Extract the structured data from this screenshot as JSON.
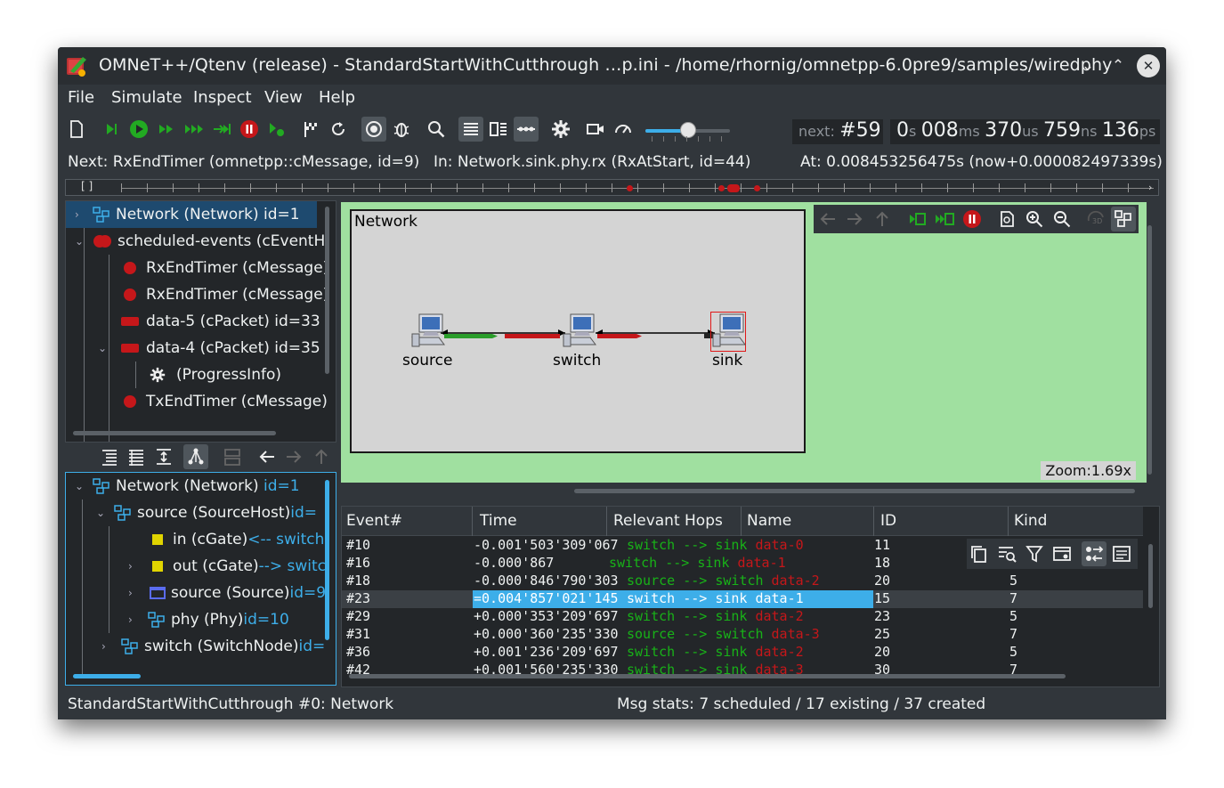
{
  "window": {
    "title": "OMNeT++/Qtenv (release) - StandardStartWithCutthrough …p.ini - /home/rhornig/omnetpp-6.0pre9/samples/wiredphy",
    "btn_minimize": "⌄",
    "btn_maximize": "⌃",
    "btn_close": "✕"
  },
  "menu": [
    "File",
    "Simulate",
    "Inspect",
    "View",
    "Help"
  ],
  "toolbar": {
    "next_label": "next:",
    "next_event": "#59",
    "time": {
      "s": "0",
      "s_unit": "s",
      "ms": "008",
      "ms_unit": "ms",
      "us": "370",
      "us_unit": "us",
      "ns": "759",
      "ns_unit": "ns",
      "ps": "136",
      "ps_unit": "ps"
    },
    "speed_slider_value": 0.5
  },
  "infobar": {
    "next": "Next: RxEndTimer (omnetpp::cMessage, id=9)",
    "in": "In: Network.sink.phy.rx (RxAtStart, id=44)",
    "at": "At: 0.008453256475s (now+0.000082497339s)"
  },
  "timeline": {
    "brackets": "[  ]"
  },
  "object_tree": [
    {
      "label": "Network (Network) id=1",
      "icon": "network-icon"
    },
    {
      "label": "scheduled-events (cEventH",
      "icon": "event-queue-icon"
    },
    {
      "label": "RxEndTimer (cMessage)",
      "icon": "message-icon"
    },
    {
      "label": "RxEndTimer (cMessage)",
      "icon": "message-icon"
    },
    {
      "label": "data-5 (cPacket) id=33",
      "icon": "packet-icon"
    },
    {
      "label": "data-4 (cPacket) id=35",
      "icon": "packet-icon"
    },
    {
      "label": "(ProgressInfo)",
      "icon": "gear-icon"
    },
    {
      "label": "TxEndTimer (cMessage)",
      "icon": "message-icon"
    }
  ],
  "module_tree": [
    {
      "label": "Network (Network) ",
      "id": "id=1"
    },
    {
      "label": "source (SourceHost) ",
      "id": "id="
    },
    {
      "label": "in (cGate) ",
      "id": "<-- switch."
    },
    {
      "label": "out (cGate) ",
      "id": "--> switc"
    },
    {
      "label": "source (Source) ",
      "id": "id=9"
    },
    {
      "label": "phy (Phy) ",
      "id": "id=10"
    },
    {
      "label": "switch (SwitchNode) ",
      "id": "id="
    }
  ],
  "network": {
    "title": "Network",
    "nodes": [
      "source",
      "switch",
      "sink"
    ],
    "zoom": "Zoom:1.69x"
  },
  "log": {
    "headers": [
      "Event#",
      "Time",
      "Relevant Hops",
      "Name",
      "ID",
      "Kind"
    ],
    "rows": [
      {
        "event": "#10",
        "time": "-0.001'503'309'067",
        "hops": "switch --> sink",
        "name": "data-0",
        "id": "11",
        "kind": ""
      },
      {
        "event": "#16",
        "time": "-0.000'867",
        "hops": "switch --> sink",
        "name": "data-1",
        "id": "18",
        "kind": ""
      },
      {
        "event": "#18",
        "time": "-0.000'846'790'303",
        "hops": "source --> switch",
        "name": "data-2",
        "id": "20",
        "kind": "5"
      },
      {
        "event": "#23",
        "time": "=0.004'857'021'145",
        "hops": "switch --> sink",
        "name": "data-1",
        "id": "15",
        "kind": "7"
      },
      {
        "event": "#29",
        "time": "+0.000'353'209'697",
        "hops": "switch --> sink",
        "name": "data-2",
        "id": "23",
        "kind": "5"
      },
      {
        "event": "#31",
        "time": "+0.000'360'235'330",
        "hops": "source --> switch",
        "name": "data-3",
        "id": "25",
        "kind": "7"
      },
      {
        "event": "#36",
        "time": "+0.001'236'209'697",
        "hops": "switch --> sink",
        "name": "data-2",
        "id": "20",
        "kind": "5"
      },
      {
        "event": "#42",
        "time": "+0.001'560'235'330",
        "hops": "switch --> sink",
        "name": "data-3",
        "id": "30",
        "kind": "7"
      }
    ]
  },
  "status": {
    "left": "StandardStartWithCutthrough #0: Network",
    "right": "Msg stats: 7 scheduled / 17 existing / 37 created"
  }
}
